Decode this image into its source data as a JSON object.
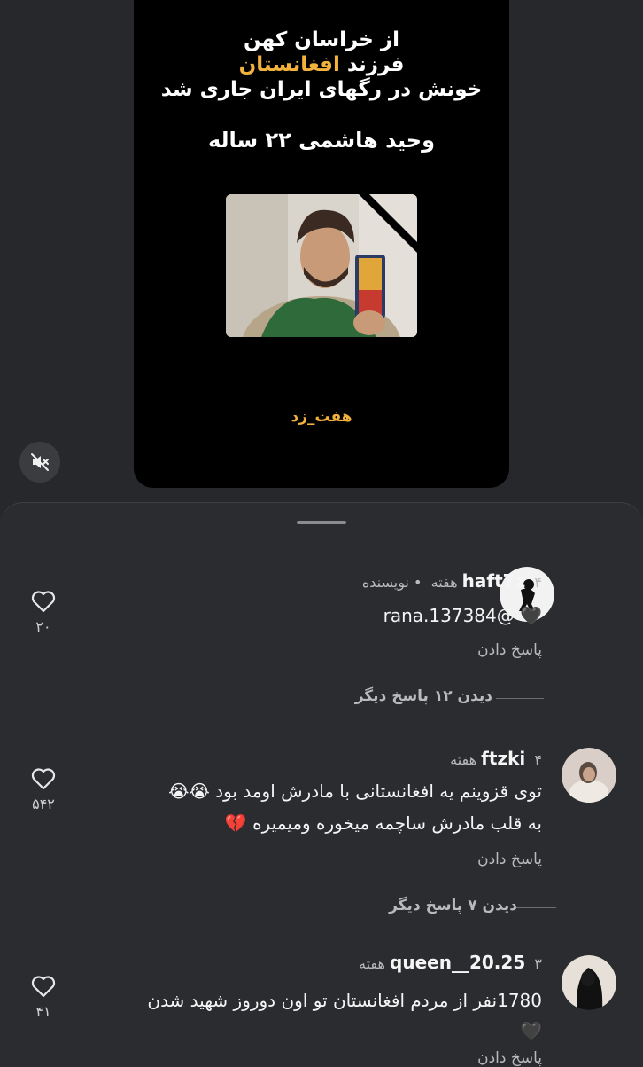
{
  "post": {
    "line1": "از خراسان کهن",
    "line2_prefix": "فرزند",
    "line2_highlight": "افغانستان",
    "line3": "خونش در رگهای ایران جاری شد",
    "line4": "وحید هاشمی ۲۲ ساله",
    "signature": "هفت_زد"
  },
  "mute_icon": "speaker-muted-icon",
  "comments": [
    {
      "username": "haft7z",
      "time": "۴ هفته",
      "badge": "• نویسنده",
      "text": "rana.137384@ 🖤",
      "reply_label": "پاسخ دادن",
      "view_replies": "دیدن ۱۲ پاسخ دیگر",
      "likes": "۲۰"
    },
    {
      "username": "ftzki",
      "time": "۴ هفته",
      "text_line1": "توی قزوینم یه افغانستانی با مادرش اومد بود 😭😭",
      "text_line2": "به قلب مادرش ساچمه میخوره ومیمیره 💔",
      "reply_label": "پاسخ دادن",
      "view_replies": "دیدن ۷ پاسخ دیگر",
      "likes": "۵۴۲"
    },
    {
      "username": "queen__20.25",
      "time": "۳ هفته",
      "text_line1": "1780نفر از مردم افغانستان تو اون دوروز شهید شدن",
      "text_line2": "🖤",
      "reply_label": "پاسخ دادن",
      "likes": "۴۱"
    }
  ],
  "colors": {
    "accent": "#f3b23c",
    "sheet": "#2a2c30",
    "card": "#000000"
  }
}
